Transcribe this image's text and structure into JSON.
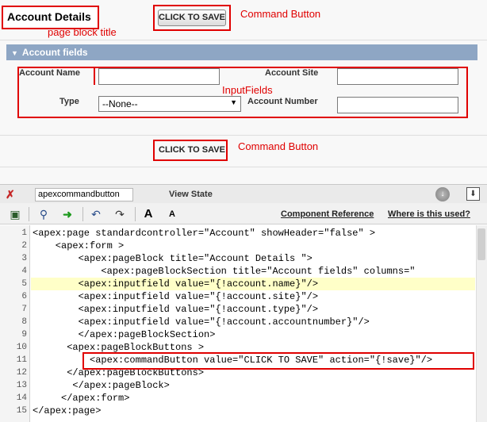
{
  "preview": {
    "page_block_title": "Account Details",
    "save_button_top": "CLICK TO SAVE",
    "save_button_bottom": "CLICK TO SAVE",
    "annotations": {
      "command_button_top": "Command Button",
      "page_block_title": "page block title",
      "input_fields": "InputFields",
      "command_button_bottom": "Command Button"
    },
    "section_title": "Account fields",
    "fields": {
      "account_name_label": "Account Name",
      "account_site_label": "Account Site",
      "type_label": "Type",
      "type_value": "--None--",
      "account_number_label": "Account Number"
    }
  },
  "devbar": {
    "component_tab": "apexcommandbutton",
    "view_state": "View State"
  },
  "toolbar": {
    "component_reference": "Component Reference",
    "where_used": "Where is this used?",
    "font_larger": "A",
    "font_smaller": "A"
  },
  "editor": {
    "line_numbers": [
      "1",
      "2",
      "3",
      "4",
      "5",
      "6",
      "7",
      "8",
      "9",
      "10",
      "11",
      "12",
      "13",
      "14",
      "15"
    ],
    "lines": [
      "<apex:page standardcontroller=\"Account\" showHeader=\"false\" >",
      "    <apex:form >",
      "        <apex:pageBlock title=\"Account Details \">",
      "            <apex:pageBlockSection title=\"Account fields\" columns=\"",
      "        <apex:inputfield value=\"{!account.name}\"/>",
      "        <apex:inputfield value=\"{!account.site}\"/>",
      "        <apex:inputfield value=\"{!account.type}\"/>",
      "        <apex:inputfield value=\"{!account.accountnumber}\"/>",
      "        </apex:pageBlockSection>",
      "      <apex:pageBlockButtons >",
      "          <apex:commandButton value=\"CLICK TO SAVE\" action=\"{!save}\"/>",
      "      </apex:pageBlockButtons>",
      "       </apex:pageBlock>",
      "     </apex:form>",
      "</apex:page>"
    ]
  },
  "colors": {
    "annotation_red": "#e00000",
    "section_header_bg": "#8ea6c4",
    "highlight_line": "#ffffc8"
  }
}
